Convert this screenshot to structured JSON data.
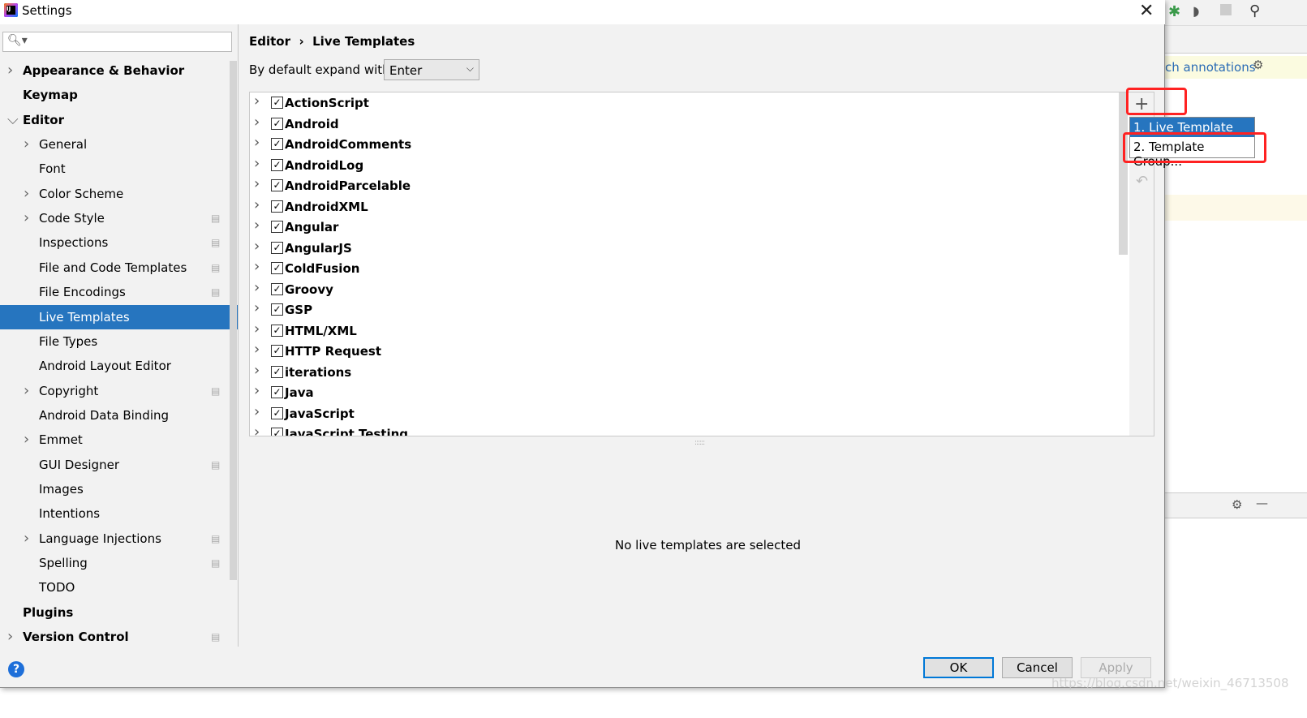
{
  "window": {
    "title": "Settings",
    "close_icon": "close-icon"
  },
  "search": {
    "placeholder": "",
    "icon": "search-icon"
  },
  "sidebar": {
    "items": [
      {
        "label": "Appearance & Behavior",
        "level": 0,
        "bold": true,
        "expandable": true
      },
      {
        "label": "Keymap",
        "level": 0,
        "bold": true
      },
      {
        "label": "Editor",
        "level": 0,
        "bold": true,
        "expandable": true,
        "expanded": true
      },
      {
        "label": "General",
        "level": 1,
        "expandable": true
      },
      {
        "label": "Font",
        "level": 1
      },
      {
        "label": "Color Scheme",
        "level": 1,
        "expandable": true
      },
      {
        "label": "Code Style",
        "level": 1,
        "expandable": true,
        "project": true
      },
      {
        "label": "Inspections",
        "level": 1,
        "project": true
      },
      {
        "label": "File and Code Templates",
        "level": 1,
        "project": true
      },
      {
        "label": "File Encodings",
        "level": 1,
        "project": true
      },
      {
        "label": "Live Templates",
        "level": 1,
        "selected": true
      },
      {
        "label": "File Types",
        "level": 1
      },
      {
        "label": "Android Layout Editor",
        "level": 1
      },
      {
        "label": "Copyright",
        "level": 1,
        "expandable": true,
        "project": true
      },
      {
        "label": "Android Data Binding",
        "level": 1
      },
      {
        "label": "Emmet",
        "level": 1,
        "expandable": true
      },
      {
        "label": "GUI Designer",
        "level": 1,
        "project": true
      },
      {
        "label": "Images",
        "level": 1
      },
      {
        "label": "Intentions",
        "level": 1
      },
      {
        "label": "Language Injections",
        "level": 1,
        "expandable": true,
        "project": true
      },
      {
        "label": "Spelling",
        "level": 1,
        "project": true
      },
      {
        "label": "TODO",
        "level": 1
      },
      {
        "label": "Plugins",
        "level": 0,
        "bold": true
      },
      {
        "label": "Version Control",
        "level": 0,
        "bold": true,
        "expandable": true,
        "project": true
      }
    ]
  },
  "breadcrumb": {
    "parent": "Editor",
    "sep": "›",
    "current": "Live Templates"
  },
  "expand": {
    "label": "By default expand with",
    "value": "Enter"
  },
  "templates": [
    "ActionScript",
    "Android",
    "AndroidComments",
    "AndroidLog",
    "AndroidParcelable",
    "AndroidXML",
    "Angular",
    "AngularJS",
    "ColdFusion",
    "Groovy",
    "GSP",
    "HTML/XML",
    "HTTP Request",
    "iterations",
    "Java",
    "JavaScript",
    "JavaScript Testing"
  ],
  "add_menu": {
    "items": [
      "1. Live Template",
      "2. Template Group..."
    ]
  },
  "empty_message": "No live templates are selected",
  "buttons": {
    "ok": "OK",
    "cancel": "Cancel",
    "apply": "Apply"
  },
  "ide": {
    "annotations": "ch annotations"
  },
  "watermark": "https://blog.csdn.net/weixin_46713508",
  "colors": {
    "selection": "#2675bf",
    "highlight": "#ff2222"
  }
}
